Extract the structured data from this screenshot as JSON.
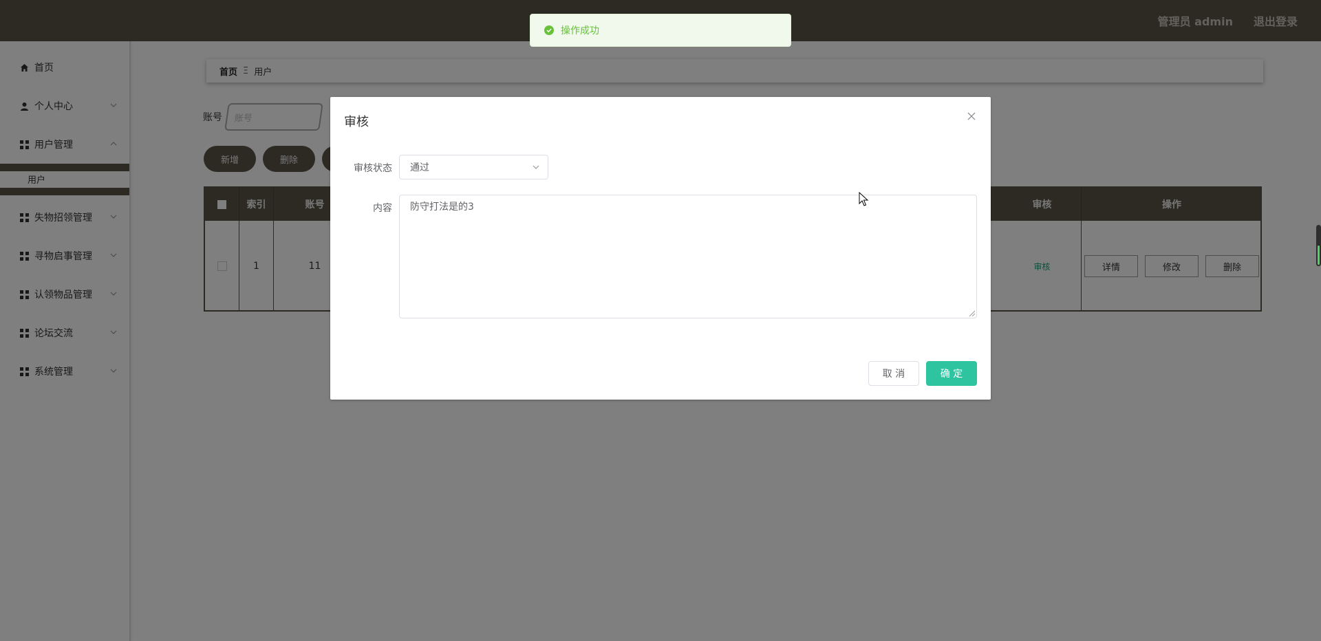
{
  "header": {
    "admin_label": "管理员 admin",
    "logout": "退出登录"
  },
  "sidebar": {
    "items": [
      {
        "label": "首页",
        "icon": "home-icon"
      },
      {
        "label": "个人中心",
        "icon": "user-icon"
      },
      {
        "label": "用户管理",
        "icon": "grid-icon"
      },
      {
        "label": "失物招领管理",
        "icon": "grid-icon"
      },
      {
        "label": "寻物启事管理",
        "icon": "grid-icon"
      },
      {
        "label": "认领物品管理",
        "icon": "grid-icon"
      },
      {
        "label": "论坛交流",
        "icon": "grid-icon"
      },
      {
        "label": "系统管理",
        "icon": "grid-icon"
      }
    ],
    "submenu_user": "用户"
  },
  "breadcrumb": {
    "home": "首页",
    "separator": "Ξ",
    "current": "用户"
  },
  "search": {
    "label": "账号",
    "placeholder": "账号"
  },
  "actions": {
    "add": "新增",
    "delete": "删除"
  },
  "table": {
    "headers": {
      "index": "索引",
      "account": "账号",
      "review": "审核",
      "operation": "操作"
    },
    "rows": [
      {
        "index": "1",
        "account": "11",
        "review": "审核",
        "detail": "详情",
        "edit": "修改",
        "delete": "删除"
      }
    ]
  },
  "toast": {
    "message": "操作成功",
    "color": "#67c23a"
  },
  "dialog": {
    "title": "审核",
    "status_label": "审核状态",
    "status_value": "通过",
    "content_label": "内容",
    "content_value": "防守打法是的3",
    "cancel": "取 消",
    "confirm": "确 定",
    "confirm_color": "#2ec4a0"
  },
  "theme": {
    "primary": "#5a5547"
  }
}
